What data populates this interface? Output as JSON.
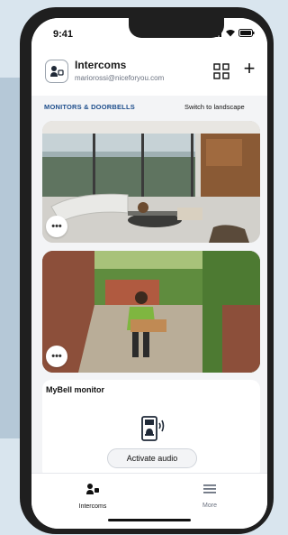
{
  "status": {
    "time": "9:41"
  },
  "header": {
    "title": "Intercoms",
    "subtitle": "mariorossi@niceforyou.com",
    "logo_icon": "intercom-icon",
    "grid_icon": "grid-icon",
    "add_icon": "plus-icon"
  },
  "section": {
    "label": "MONITORS & DOORBELLS",
    "switch_label": "Switch to landscape"
  },
  "cameras": [
    {
      "name": "living-room-camera",
      "more_label": "•••"
    },
    {
      "name": "front-door-camera",
      "more_label": "•••"
    }
  ],
  "mybell": {
    "title": "MyBell monitor",
    "icon": "doorbell-audio-icon",
    "button_label": "Activate audio"
  },
  "tabs": [
    {
      "label": "Intercoms",
      "icon": "intercom-icon",
      "active": true
    },
    {
      "label": "More",
      "icon": "menu-icon",
      "active": false
    }
  ],
  "colors": {
    "accent": "#1e4e8c",
    "background": "#d9e5ee"
  }
}
